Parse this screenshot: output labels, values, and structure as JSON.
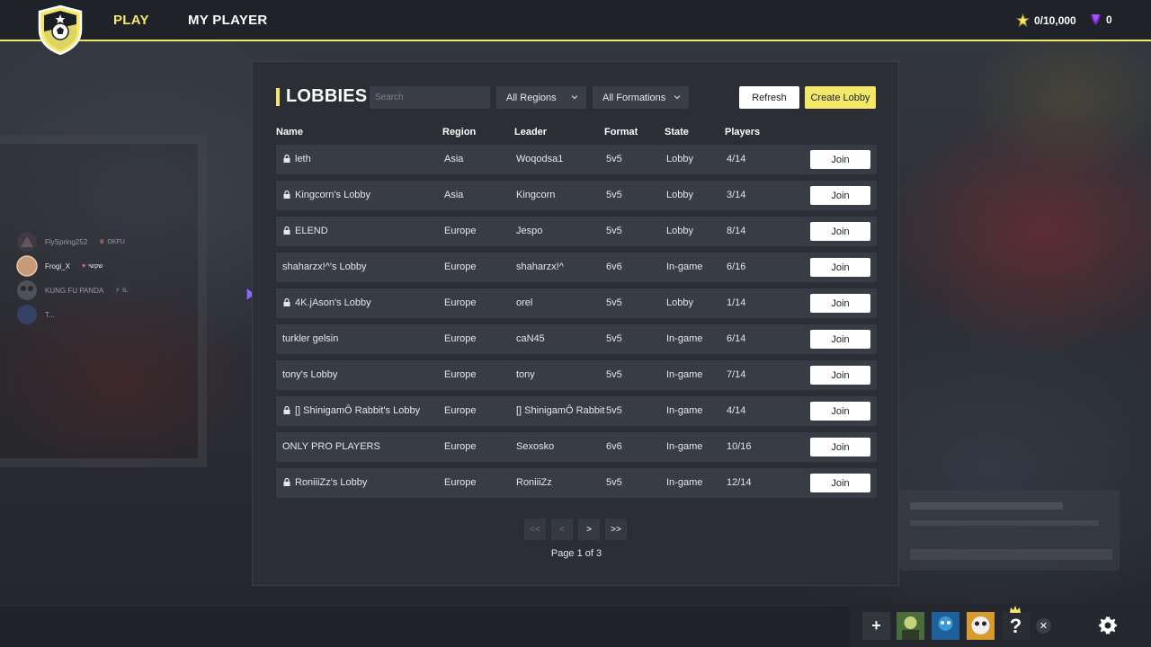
{
  "nav": {
    "play": "PLAY",
    "my_player": "MY PLAYER",
    "stars": "0/10,000",
    "gems": "0"
  },
  "friends": [
    {
      "name": "FlySpring252",
      "tag": "OKFU"
    },
    {
      "name": "Frogi_X",
      "tag": "שקשי"
    },
    {
      "name": "KUNG FU PANDA",
      "tag": "IL"
    },
    {
      "name": "T..."
    }
  ],
  "lobbies": {
    "title": "LOBBIES",
    "search_placeholder": "Search",
    "region_filter": "All Regions",
    "formation_filter": "All Formations",
    "refresh_label": "Refresh",
    "create_label": "Create Lobby",
    "columns": {
      "name": "Name",
      "region": "Region",
      "leader": "Leader",
      "format": "Format",
      "state": "State",
      "players": "Players"
    },
    "join_label": "Join",
    "rows": [
      {
        "locked": true,
        "name": "leth",
        "region": "Asia",
        "leader": "Woqodsa1",
        "format": "5v5",
        "state": "Lobby",
        "players": "4/14"
      },
      {
        "locked": true,
        "name": "Kingcorn's Lobby",
        "region": "Asia",
        "leader": "Kingcorn",
        "format": "5v5",
        "state": "Lobby",
        "players": "3/14"
      },
      {
        "locked": true,
        "name": "ELEND",
        "region": "Europe",
        "leader": "Jespo",
        "format": "5v5",
        "state": "Lobby",
        "players": "8/14"
      },
      {
        "locked": false,
        "name": "shaharzx!^'s Lobby",
        "region": "Europe",
        "leader": "shaharzx!^",
        "format": "6v6",
        "state": "In-game",
        "players": "6/16"
      },
      {
        "locked": true,
        "name": "4K.jAson's Lobby",
        "region": "Europe",
        "leader": "orel",
        "format": "5v5",
        "state": "Lobby",
        "players": "1/14"
      },
      {
        "locked": false,
        "name": "turkler gelsin",
        "region": "Europe",
        "leader": "caN45",
        "format": "5v5",
        "state": "In-game",
        "players": "6/14"
      },
      {
        "locked": false,
        "name": "tony's Lobby",
        "region": "Europe",
        "leader": "tony",
        "format": "5v5",
        "state": "In-game",
        "players": "7/14"
      },
      {
        "locked": true,
        "name": "[] ShinigamÔ Rabbit's Lobby",
        "region": "Europe",
        "leader": "[] ShinigamÔ Rabbit",
        "format": "5v5",
        "state": "In-game",
        "players": "4/14"
      },
      {
        "locked": false,
        "name": "ONLY PRO PLAYERS",
        "region": "Europe",
        "leader": "Sexosko",
        "format": "6v6",
        "state": "In-game",
        "players": "10/16"
      },
      {
        "locked": true,
        "name": "RoniiiZz's Lobby",
        "region": "Europe",
        "leader": "RoniiiZz",
        "format": "5v5",
        "state": "In-game",
        "players": "12/14"
      }
    ],
    "pager": {
      "first": "<<",
      "prev": "<",
      "next": ">",
      "last": ">>",
      "info": "Page 1 of 3"
    }
  },
  "party": {
    "add": "+",
    "close": "✕",
    "unknown_slot": "?"
  },
  "colors": {
    "accent": "#f3e86a",
    "panel": "#2b2e35",
    "row": "#383c44"
  }
}
